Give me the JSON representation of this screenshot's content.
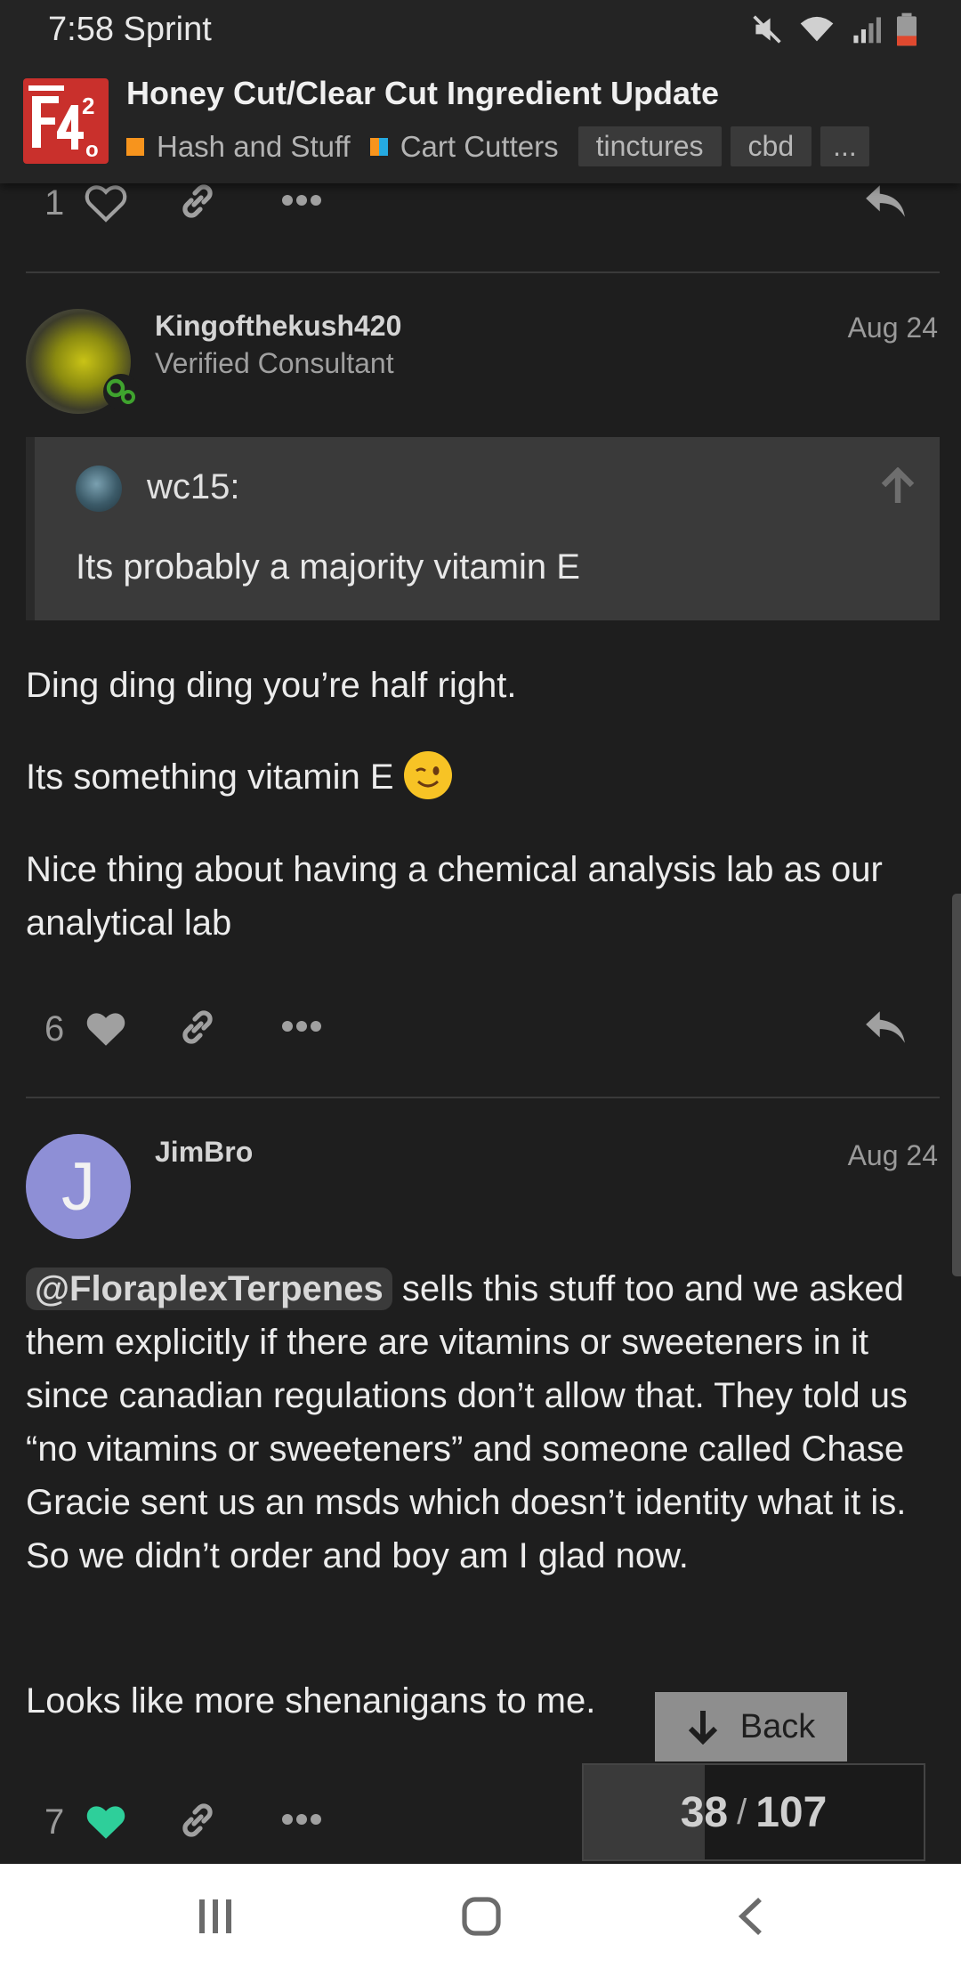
{
  "status": {
    "time": "7:58",
    "carrier": "Sprint"
  },
  "topic": {
    "title": "Honey Cut/Clear Cut Ingredient Update",
    "categories": [
      "Hash and Stuff",
      "Cart Cutters"
    ],
    "tags": [
      "tinctures",
      "cbd",
      "..."
    ],
    "colors": {
      "hash_and_stuff": "#f7941d",
      "cart_cutters_left": "#f7941d",
      "cart_cutters_right": "#25aae1"
    }
  },
  "post_prev": {
    "like_count": "1"
  },
  "post_king": {
    "username": "Kingofthekush420",
    "user_title": "Verified Consultant",
    "date": "Aug 24",
    "quote": {
      "author": "wc15:",
      "text": "Its probably a majority vitamin E"
    },
    "paragraphs": [
      "Ding ding ding you’re half right.",
      "Its something vitamin E",
      "Nice thing about having a chemical analysis lab as our analytical lab"
    ],
    "like_count": "6"
  },
  "post_jim": {
    "username": "JimBro",
    "avatar_letter": "J",
    "avatar_color": "#8e8fd6",
    "date": "Aug 24",
    "mention": "@FloraplexTerpenes",
    "paragraph1_rest": " sells this stuff too and we asked them explicitly if there are vitamins or sweeteners in it since canadian regulations don’t allow that. They told us “no vitamins or sweeteners” and someone called Chase Gracie sent us an msds which doesn’t identity what it is. So we didn’t order and boy am I glad now.",
    "paragraph2": "Looks like more shenanigans to me.",
    "like_count": "7",
    "liked_color": "#2ecf9a"
  },
  "nav": {
    "back_label": "Back",
    "current": "38",
    "separator": "/",
    "total": "107",
    "progress_fraction": 0.355
  }
}
